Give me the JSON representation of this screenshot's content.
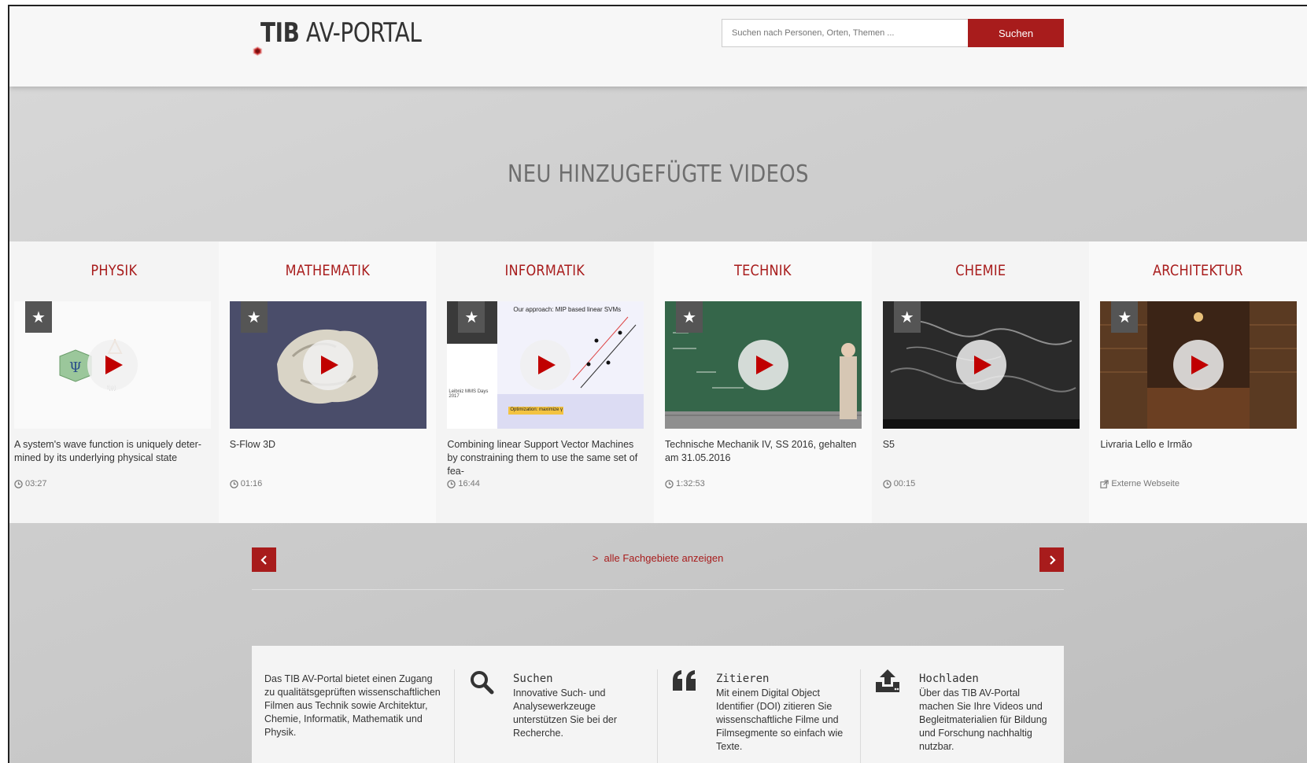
{
  "header": {
    "logo_bold": "TIB",
    "logo_rest": "AV-PORTAL",
    "search_placeholder": "Suchen nach Personen, Orten, Themen ...",
    "search_button": "Suchen",
    "brand_color": "#a81c1c"
  },
  "hero": {
    "title": "NEU HINZUGEFÜGTE VIDEOS"
  },
  "categories": [
    {
      "title": "PHYSIK",
      "video_title": "A system's wave function is uniquely deter-mined by its underlying physical state",
      "meta": "03:27",
      "meta_icon": "clock-icon"
    },
    {
      "title": "MATHEMATIK",
      "video_title": "S-Flow 3D",
      "meta": "01:16",
      "meta_icon": "clock-icon"
    },
    {
      "title": "INFORMATIK",
      "video_title": "Combining linear Support Vector Machines by constraining them to use the same set of fea-",
      "meta": "16:44",
      "meta_icon": "clock-icon",
      "thumb_text": {
        "heading": "Our approach: MIP based linear SVMs",
        "event": "Leibniz MMS Days 2017",
        "highlight": "Optimization: maximize γ"
      }
    },
    {
      "title": "TECHNIK",
      "video_title": "Technische Mechanik IV, SS 2016, gehalten am 31.05.2016",
      "meta": "1:32:53",
      "meta_icon": "clock-icon"
    },
    {
      "title": "CHEMIE",
      "video_title": "S5",
      "meta": "00:15",
      "meta_icon": "clock-icon"
    },
    {
      "title": "ARCHITEKTUR",
      "video_title": "Livraria Lello e Irmão",
      "meta": "Externe Webseite",
      "meta_icon": "external-link-icon"
    }
  ],
  "nav": {
    "all_link": "alle Fachgebiete anzeigen"
  },
  "info": {
    "intro": "Das TIB AV-Portal bietet einen Zugang zu qualitätsgeprüften wissenschaftlichen Filmen aus Technik sowie Architektur, Chemie, Informatik, Mathematik und Physik.",
    "features": [
      {
        "title": "Suchen",
        "text": "Innovative Such- und Analysewerkzeuge unterstützen Sie bei der Recherche.",
        "icon": "search-icon"
      },
      {
        "title": "Zitieren",
        "text": "Mit einem Digital Object Identifier (DOI) zitieren Sie wissenschaftliche Filme und Filmsegmente so einfach wie Texte.",
        "icon": "quote-icon"
      },
      {
        "title": "Hochladen",
        "text": "Über das TIB AV-Portal machen Sie Ihre Videos und Begleitmaterialien für Bildung und Forschung nachhaltig nutzbar.",
        "icon": "upload-icon"
      }
    ]
  }
}
